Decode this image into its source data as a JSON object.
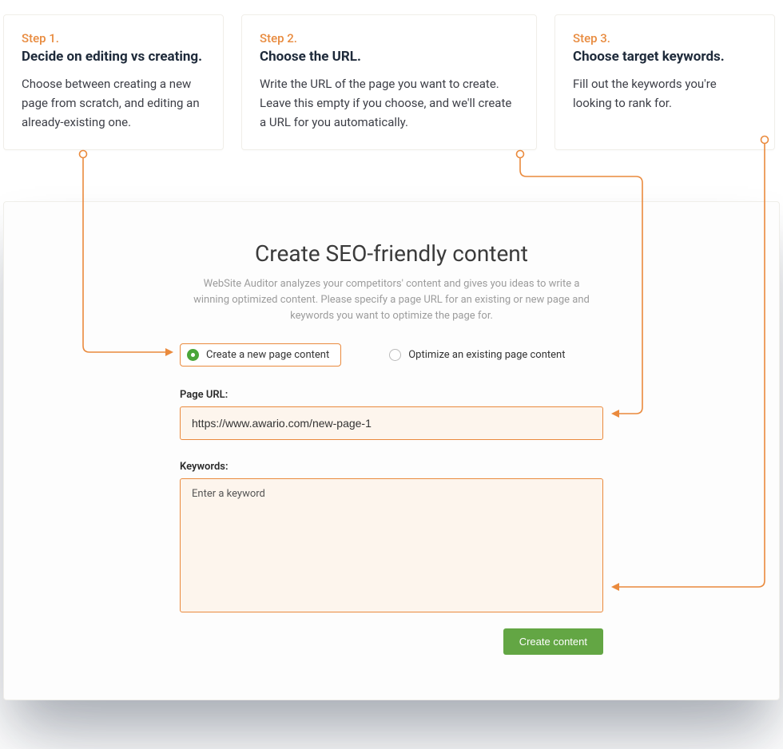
{
  "steps": [
    {
      "label": "Step 1.",
      "title": "Decide on editing vs creating.",
      "desc": "Choose between creating a new page from scratch, and editing an already-existing one."
    },
    {
      "label": "Step 2.",
      "title": "Choose the URL.",
      "desc": "Write the URL of the page you want to create. Leave this empty if you choose, and we'll create a URL for you automatically."
    },
    {
      "label": "Step 3.",
      "title": "Choose target keywords.",
      "desc": "Fill out the keywords you're looking to rank for."
    }
  ],
  "panel": {
    "title": "Create SEO-friendly content",
    "subtitle": "WebSite Auditor analyzes your competitors' content and gives you ideas to write a winning optimized content. Please specify a page URL for an existing or new page and keywords you want to optimize the page for.",
    "radio_create": "Create a new page content",
    "radio_optimize": "Optimize an existing page content",
    "page_url_label": "Page URL:",
    "page_url_value": "https://www.awario.com/new-page-1",
    "keywords_label": "Keywords:",
    "keywords_placeholder": "Enter a keyword",
    "create_button": "Create content"
  }
}
